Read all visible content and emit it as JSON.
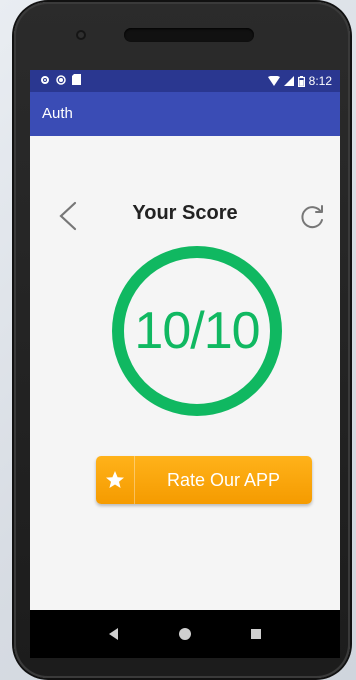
{
  "status_bar": {
    "time": "8:12"
  },
  "app_bar": {
    "title": "Auth"
  },
  "score": {
    "title": "Your Score",
    "value": "10/10"
  },
  "rate_button": {
    "label": "Rate Our APP"
  },
  "colors": {
    "status_bar": "#2a3790",
    "app_bar": "#3a4cb5",
    "score_green": "#10b861",
    "rate_orange": "#f59b00"
  },
  "icons": {
    "back": "chevron-left-icon",
    "refresh": "refresh-icon",
    "star": "star-icon",
    "nav_back": "nav-back-icon",
    "nav_home": "nav-home-icon",
    "nav_recents": "nav-recents-icon"
  }
}
